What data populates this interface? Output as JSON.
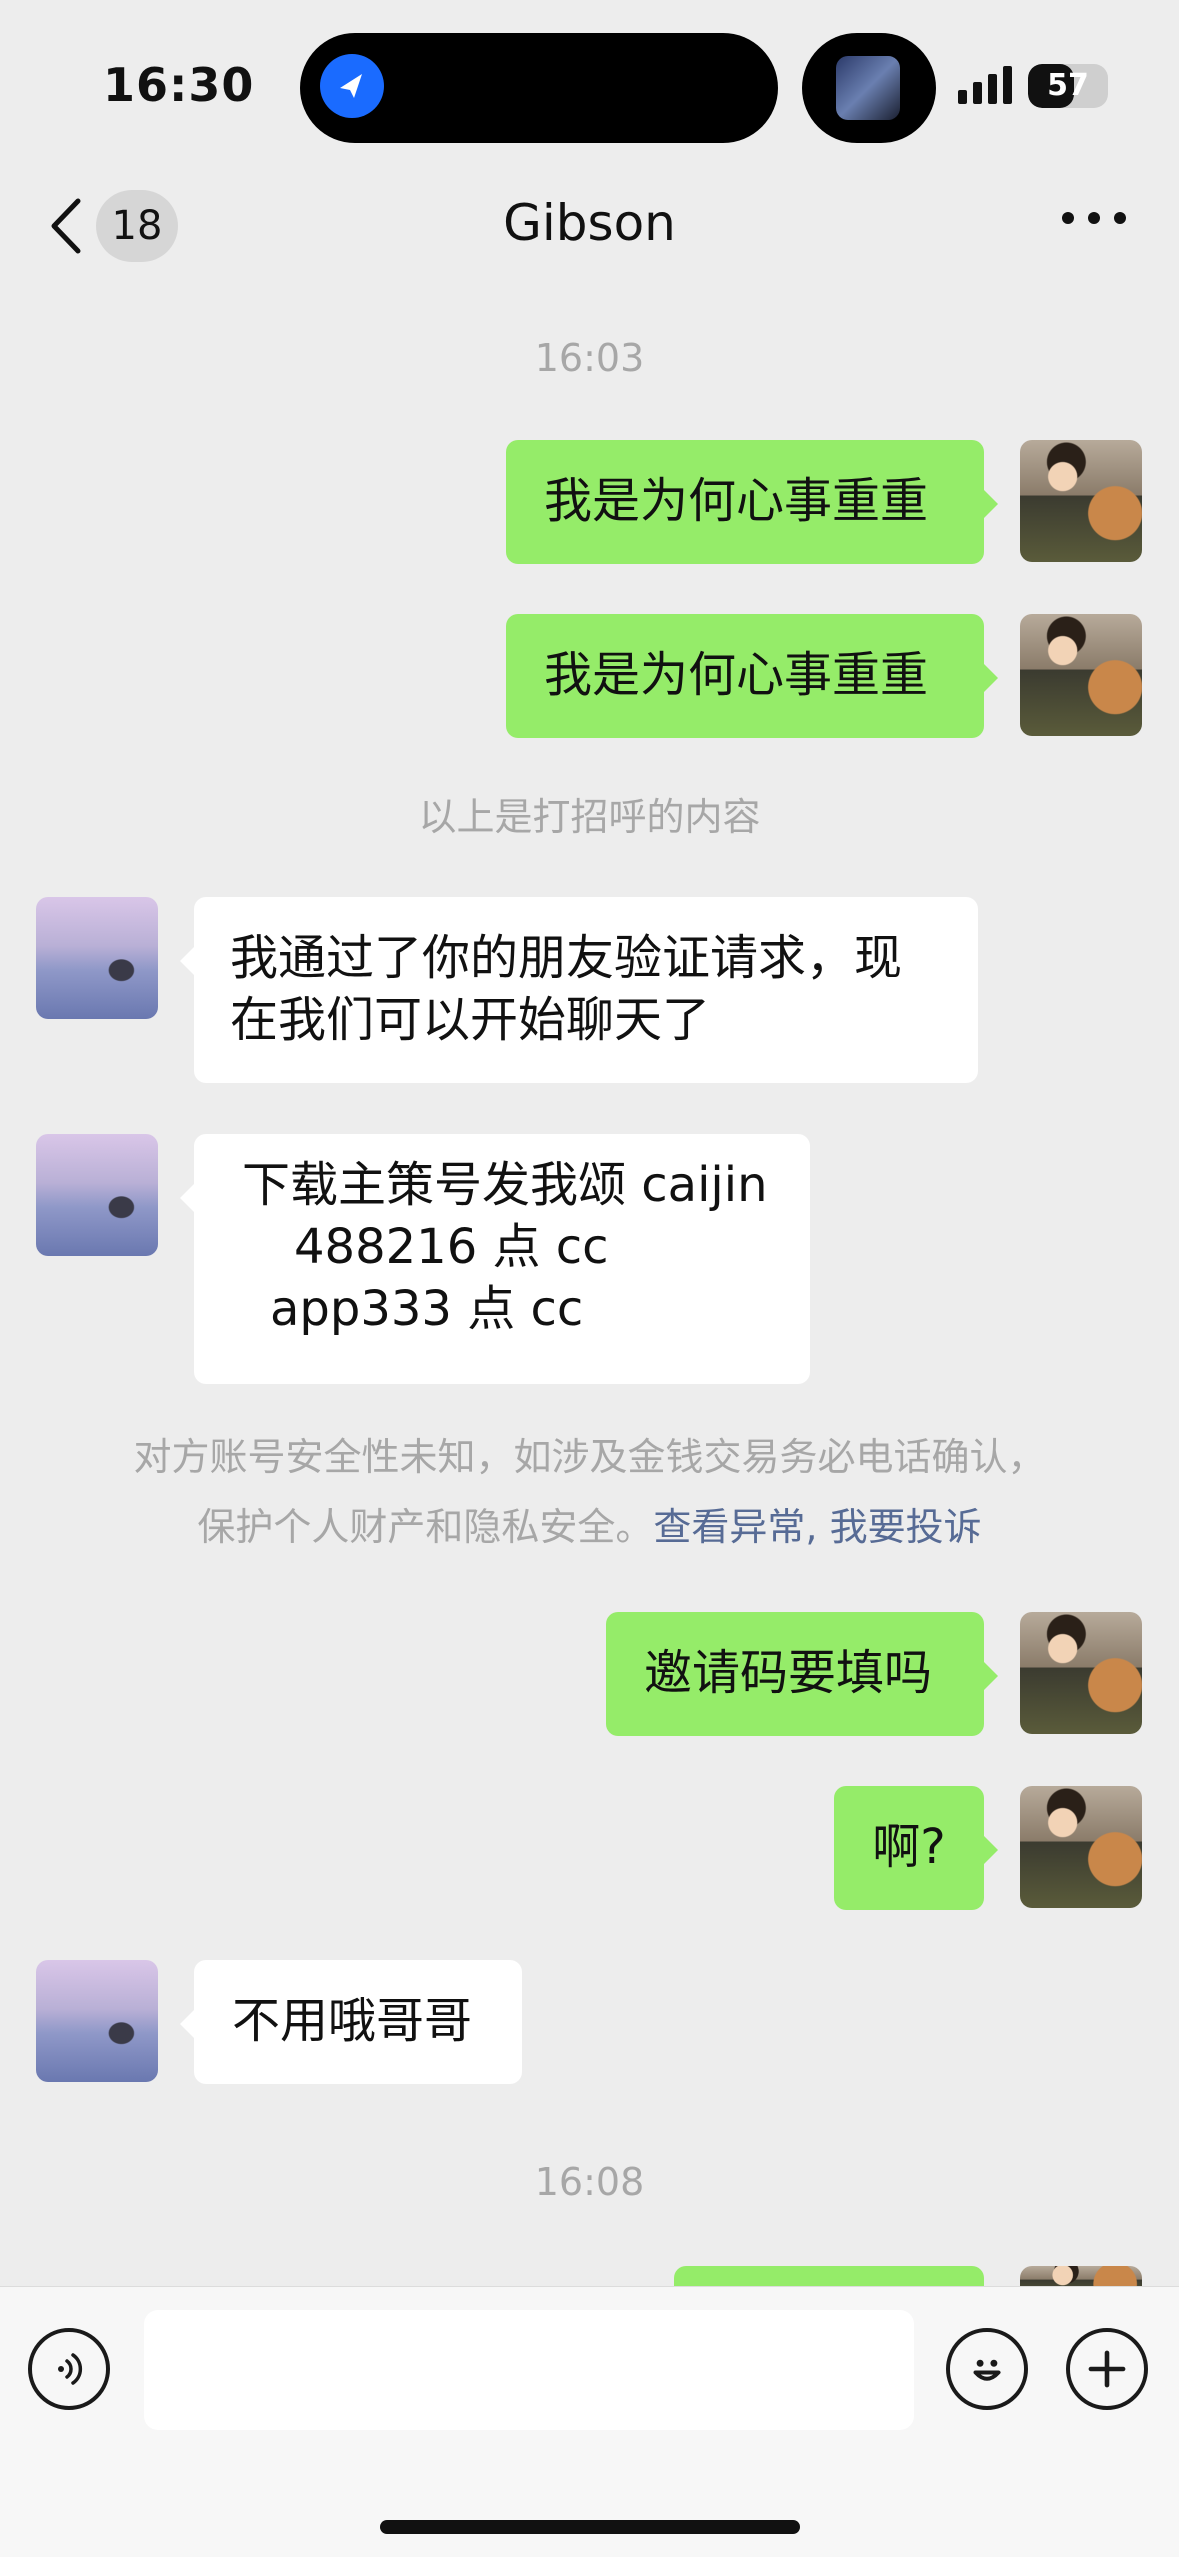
{
  "status_bar": {
    "time": "16:30",
    "battery": "57",
    "battery_level": 0.57
  },
  "nav": {
    "unread_count": "18",
    "title": "Gibson"
  },
  "messages": {
    "time1": "16:03",
    "me1": "我是为何心事重重",
    "me2": "我是为何心事重重",
    "greeting_note": "以上是打招呼的内容",
    "her1": "我通过了你的朋友验证请求，现在我们可以开始聊天了",
    "her2_line1": "下载主策号发我颂 caijin",
    "her2_line2": "488216 点 cc",
    "her2_line3": "app333 点 cc",
    "security_note_line1": "对方账号安全性未知，如涉及金钱交易务必电话确认，",
    "security_note_line2": "保护个人财产和隐私安全。",
    "link_view": "查看异常",
    "link_sep": ", ",
    "link_report": "我要投诉",
    "me3": "邀请码要填吗",
    "me4": "啊?",
    "her3": "不用哦哥哥",
    "time2": "16:08"
  },
  "input": {
    "placeholder": ""
  },
  "icons": {
    "back": "chevron-left-icon",
    "more": "more-icon",
    "voice": "voice-icon",
    "emoji": "emoji-icon",
    "add": "plus-icon",
    "feishu": "app-icon"
  },
  "colors": {
    "sent_bubble": "#95ec69",
    "received_bubble": "#ffffff",
    "link": "#576b95",
    "background": "#ededed"
  }
}
